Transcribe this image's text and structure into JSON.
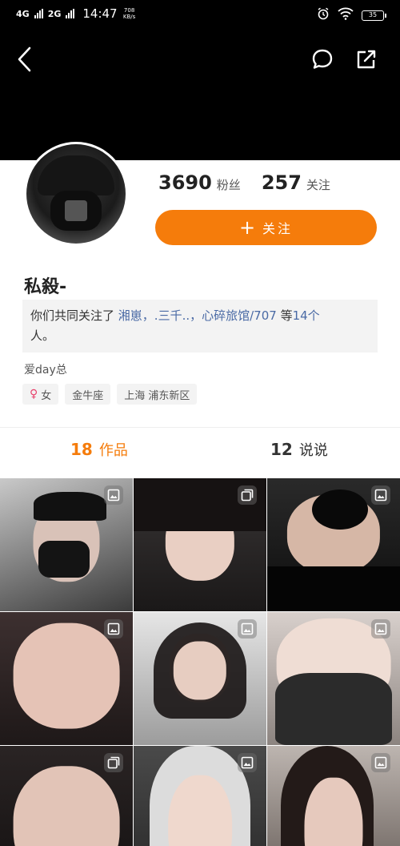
{
  "status_bar": {
    "network": "4G",
    "network2": "2G",
    "time": "14:47",
    "speed": "708 KB/s",
    "battery": "35"
  },
  "profile": {
    "fans_count": "3690",
    "fans_label": "粉丝",
    "following_count": "257",
    "following_label": "关注",
    "follow_button": "关注",
    "nickname": "私殺-",
    "mutual_prefix": "你们共同关注了",
    "mutual_names": "湘崽，.三千..，心碎旅馆/707",
    "mutual_suffix_pre": "等",
    "mutual_count": "14个",
    "mutual_suffix": "人。",
    "bio": "爱day总",
    "tags": {
      "gender": "女",
      "zodiac": "金牛座",
      "location": "上海 浦东新区"
    }
  },
  "tabs": {
    "works_count": "18",
    "works_label": "作品",
    "posts_count": "12",
    "posts_label": "说说"
  },
  "grid_icons": [
    "photo-icon",
    "multi-image-icon",
    "photo-icon",
    "photo-icon",
    "photo-icon",
    "photo-icon",
    "multi-image-icon",
    "photo-icon",
    "photo-icon"
  ],
  "colors": {
    "accent": "#f57c0b",
    "link": "#4a6aa5",
    "header_bg": "#000000"
  }
}
